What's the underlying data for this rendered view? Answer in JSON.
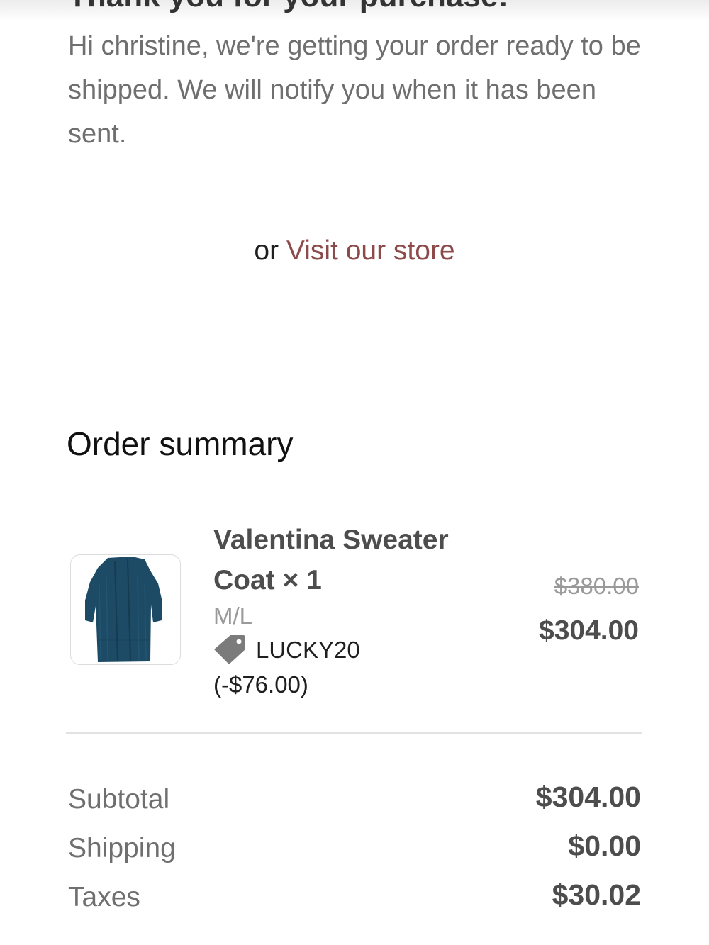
{
  "header": {
    "title_partial": "Thank you for your purchase!"
  },
  "intro": {
    "message": "Hi christine, we're getting your order ready to be shipped. We will notify you when it has been sent."
  },
  "store": {
    "prefix": "or",
    "link_label": "Visit our store"
  },
  "summary": {
    "title": "Order summary",
    "item": {
      "name": "Valentina Sweater Coat × 1",
      "variant": "M/L",
      "discount_code": "LUCKY20 (-$76.00)",
      "original_price": "$380.00",
      "price": "$304.00",
      "image_icon": "navy-sweater-coat-thumbnail"
    },
    "totals": [
      {
        "label": "Subtotal",
        "value": "$304.00"
      },
      {
        "label": "Shipping",
        "value": "$0.00"
      },
      {
        "label": "Taxes",
        "value": "$30.02"
      }
    ]
  },
  "colors": {
    "link": "#8c4a4a",
    "muted_text": "#6f6f6f",
    "emphasis_text": "#4d4d4d",
    "coat": "#1d4b66"
  },
  "icons": {
    "discount": "tag-icon"
  }
}
